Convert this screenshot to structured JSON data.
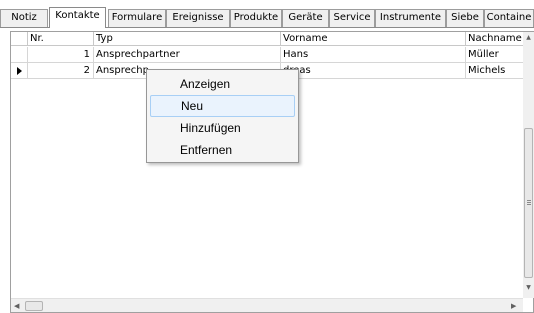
{
  "tabs": [
    {
      "label": "Notiz"
    },
    {
      "label": "Kontakte"
    },
    {
      "label": "Formulare"
    },
    {
      "label": "Ereignisse"
    },
    {
      "label": "Produkte"
    },
    {
      "label": "Geräte"
    },
    {
      "label": "Service"
    },
    {
      "label": "Instrumente"
    },
    {
      "label": "Siebe"
    },
    {
      "label": "Containe"
    }
  ],
  "active_tab": "Kontakte",
  "grid": {
    "columns": {
      "nr": "Nr.",
      "typ": "Typ",
      "vorname": "Vorname",
      "nachname": "Nachname"
    },
    "rows": [
      {
        "nr": "1",
        "typ": "Ansprechpartner",
        "vorname": "Hans",
        "nachname": "Müller"
      },
      {
        "nr": "2",
        "typ": "Ansprechp",
        "vorname": "dreas",
        "nachname": "Michels"
      }
    ],
    "selected_row": 2
  },
  "context_menu": {
    "items": [
      {
        "label": "Anzeigen"
      },
      {
        "label": "Neu"
      },
      {
        "label": "Hinzufügen"
      },
      {
        "label": "Entfernen"
      }
    ],
    "highlighted": "Neu"
  },
  "icons": {
    "row_indicator": "right-triangle-arrow-icon",
    "scroll_up": "scroll-up-arrow-icon",
    "scroll_down": "scroll-down-arrow-icon",
    "scroll_left": "scroll-left-arrow-icon",
    "scroll_right": "scroll-right-arrow-icon"
  },
  "colors": {
    "menu_highlight": "#eaf3fd",
    "menu_highlight_border": "#a8cff5"
  }
}
